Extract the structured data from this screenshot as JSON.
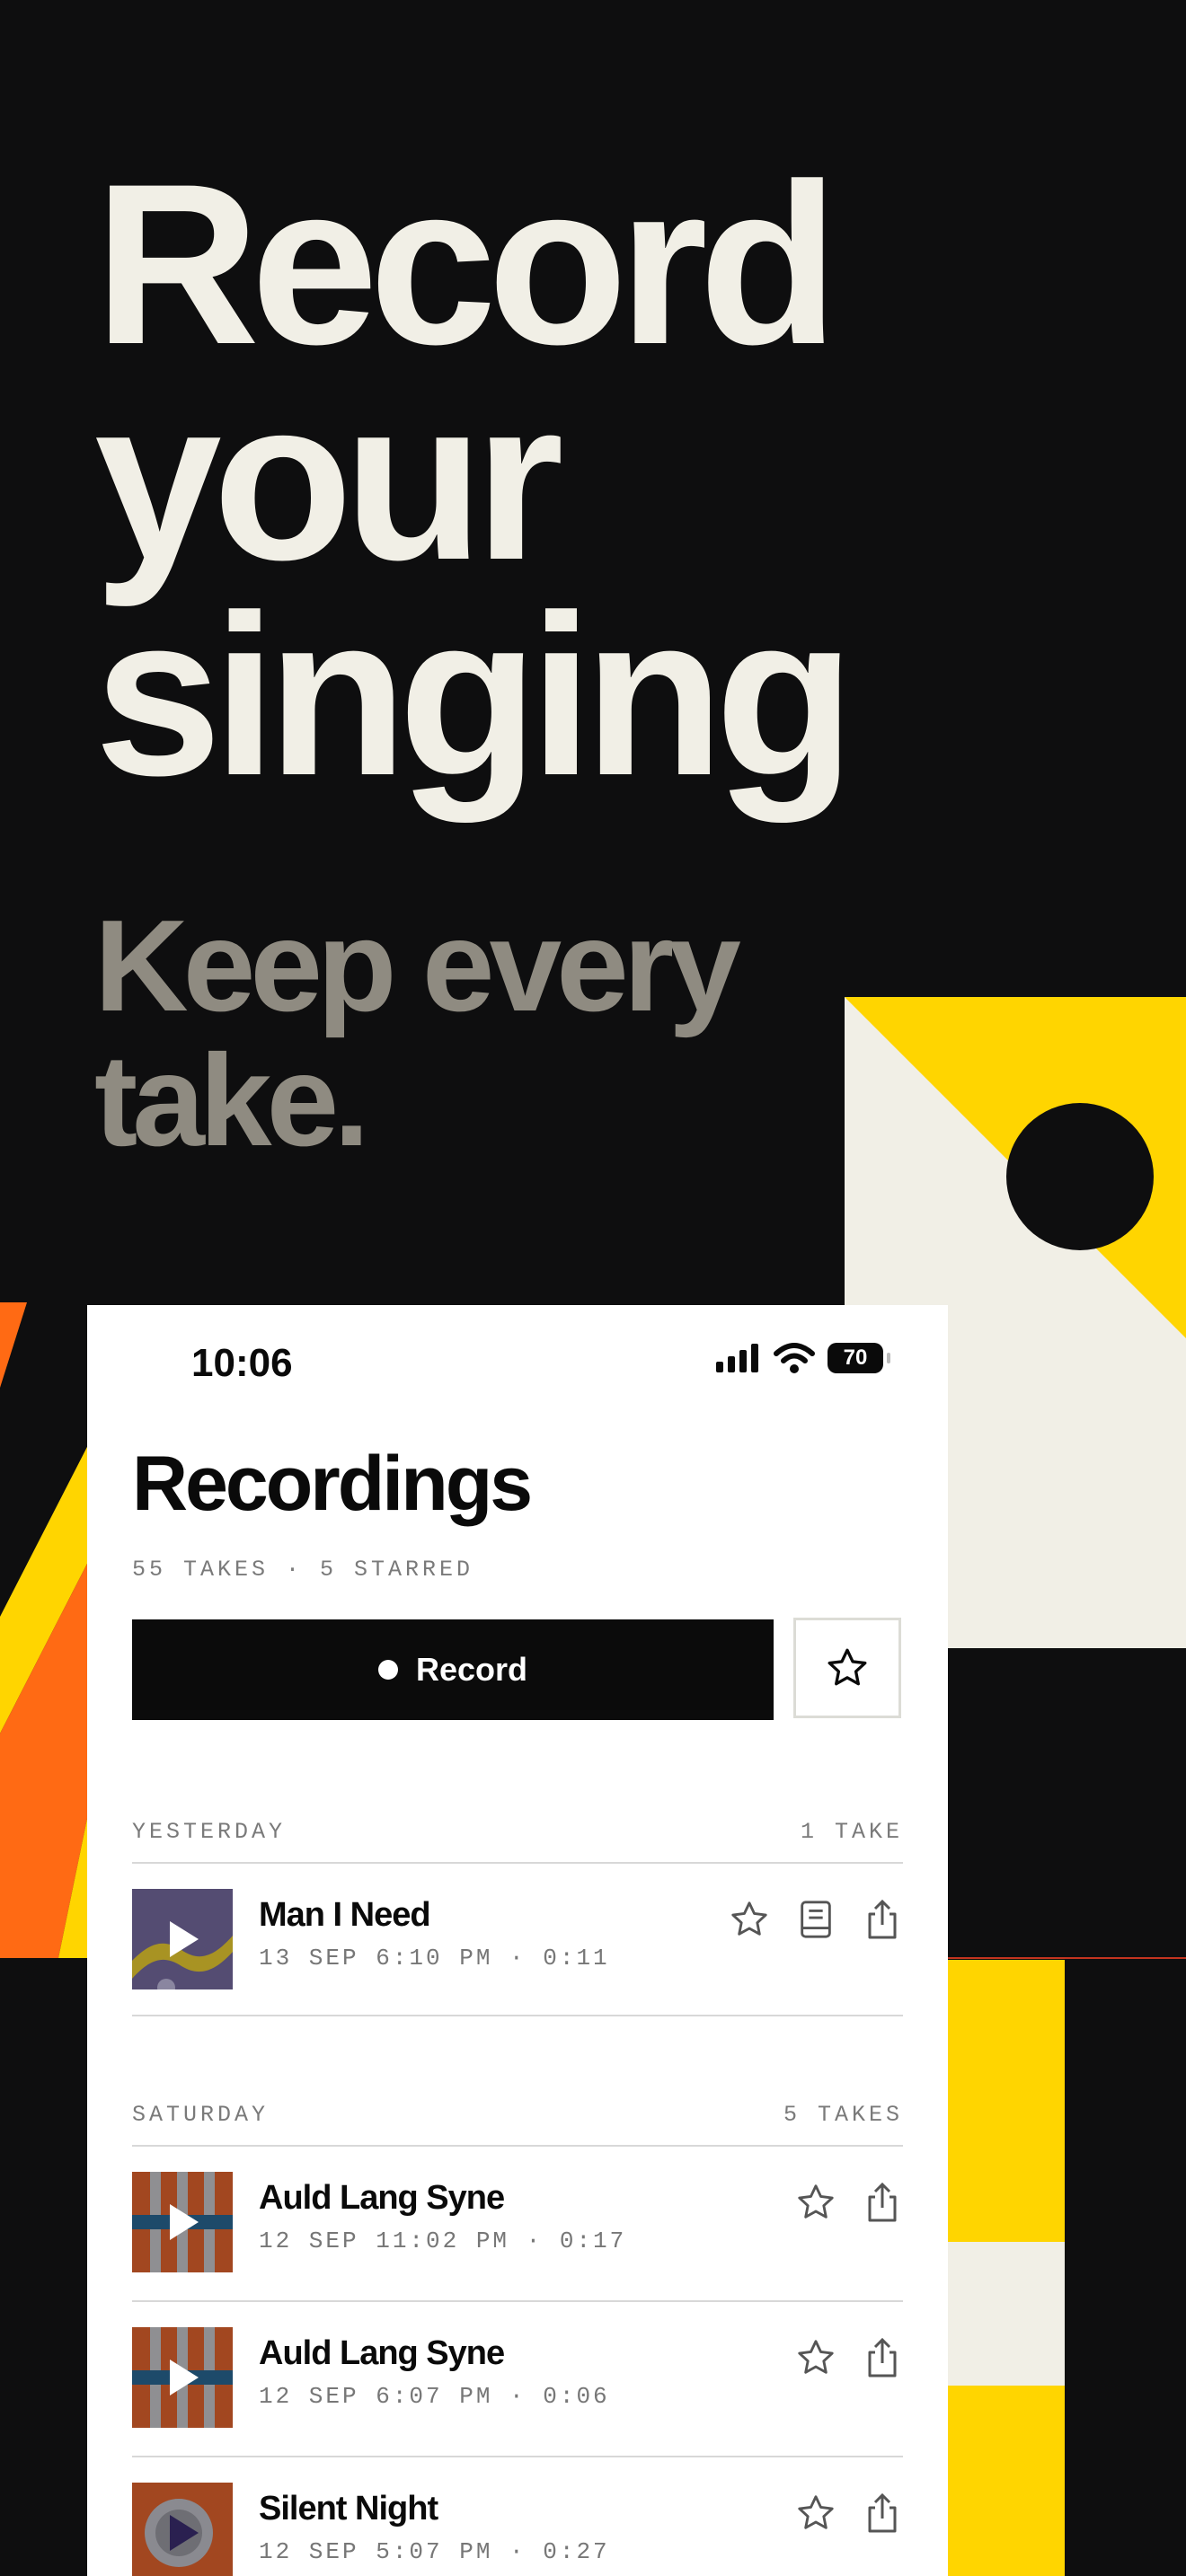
{
  "hero": {
    "line1": "Record",
    "line2": "your",
    "line3": "singing"
  },
  "tagline": {
    "line1": "Keep every",
    "line2": "take."
  },
  "status_bar": {
    "time": "10:06",
    "battery": "70"
  },
  "screen": {
    "title": "Recordings",
    "stats": "55 TAKES · 5 STARRED",
    "record_label": "Record"
  },
  "sections": [
    {
      "day": "YESTERDAY",
      "count": "1 TAKE",
      "rows": [
        {
          "title": "Man I Need",
          "meta": "13 SEP 6:10 PM · 0:11",
          "thumb": "purple",
          "lyrics_icon": true
        }
      ]
    },
    {
      "day": "SATURDAY",
      "count": "5 TAKES",
      "rows": [
        {
          "title": "Auld Lang Syne",
          "meta": "12 SEP 11:02 PM · 0:17",
          "thumb": "stripes"
        },
        {
          "title": "Auld Lang Syne",
          "meta": "12 SEP 6:07 PM · 0:06",
          "thumb": "stripes"
        },
        {
          "title": "Silent Night",
          "meta": "12 SEP 5:07 PM · 0:27",
          "thumb": "record"
        }
      ]
    }
  ],
  "colors": {
    "background": "#0e0e0f",
    "hero_text": "#f1efe6",
    "tagline_text": "#8f8b81",
    "accent_yellow": "#ffd500",
    "accent_orange": "#ff6a14",
    "cream": "#f1efe6"
  }
}
